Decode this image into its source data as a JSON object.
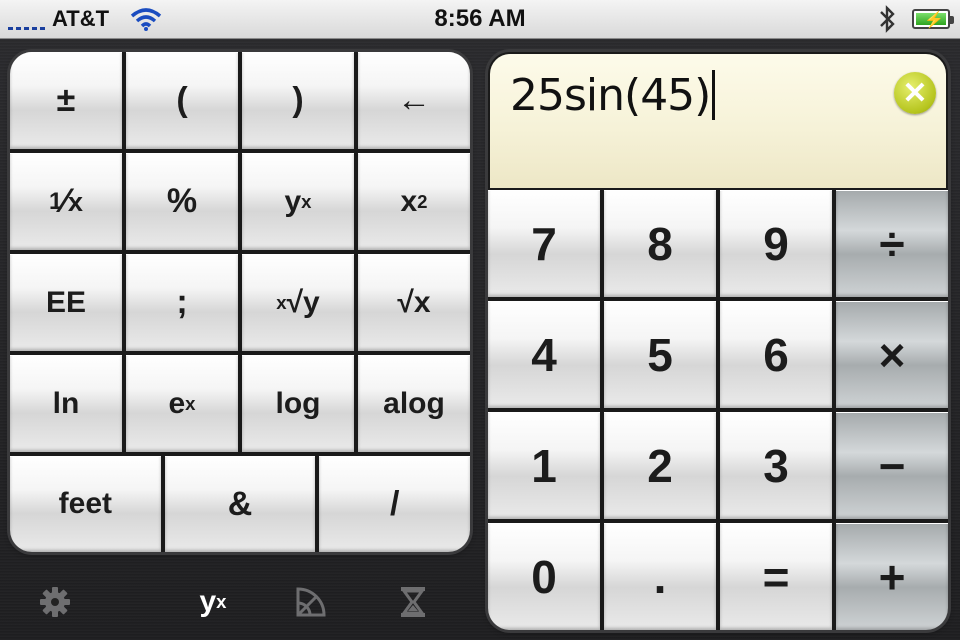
{
  "status_bar": {
    "carrier": "AT&T",
    "time": "8:56 AM",
    "signal_icon": "signal-bars-icon",
    "wifi_icon": "wifi-icon",
    "bluetooth_icon": "bluetooth-icon",
    "battery_icon": "battery-charging-icon"
  },
  "display": {
    "expression": "25sin(45)",
    "clear_icon": "clear-x-icon",
    "clear_glyph": "✕",
    "clear_color": "#c3d12a"
  },
  "left_keys": {
    "r1": [
      "±",
      "(",
      ")",
      "←"
    ],
    "r2_c1_base": "1",
    "r2_c1_den": "x",
    "r2_c2": "%",
    "r2_c3_base": "y",
    "r2_c3_exp": "x",
    "r2_c4_base": "x",
    "r2_c4_exp": "2",
    "r3_c1": "EE",
    "r3_c2": ";",
    "r3_c3_idx": "x",
    "r3_c3_rad": "√y",
    "r3_c4_rad": "√x",
    "r4_c1": "ln",
    "r4_c2_base": "e",
    "r4_c2_exp": "x",
    "r4_c3": "log",
    "r4_c4": "alog",
    "bottom": [
      "feet",
      "&",
      "/"
    ]
  },
  "right_keys": {
    "rows": [
      [
        "7",
        "8",
        "9",
        "÷"
      ],
      [
        "4",
        "5",
        "6",
        "×"
      ],
      [
        "1",
        "2",
        "3",
        "−"
      ],
      [
        "0",
        ".",
        "=",
        "+"
      ]
    ]
  },
  "toolbar": {
    "settings_icon": "gear-icon",
    "function_base": "y",
    "function_exp": "x",
    "geometry_icon": "protractor-icon",
    "timer_icon": "hourglass-icon"
  },
  "colors": {
    "operator_key": "#b9bec0",
    "display_bg": "#f6f2d8",
    "toolbar_active": "#ffffff",
    "toolbar_inactive": "#6e6e70"
  }
}
